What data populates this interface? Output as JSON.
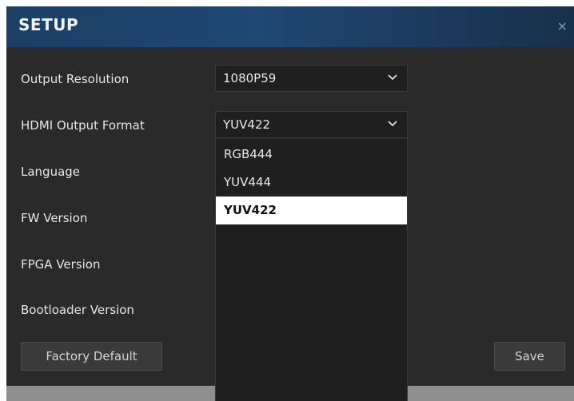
{
  "dialog": {
    "title": "SETUP",
    "close_glyph": "×"
  },
  "settings": {
    "output_resolution": {
      "label": "Output Resolution",
      "value": "1080P59"
    },
    "hdmi_output_format": {
      "label": "HDMI Output Format",
      "value": "YUV422",
      "options": [
        "RGB444",
        "YUV444",
        "YUV422"
      ],
      "selected": "YUV422"
    },
    "language": {
      "label": "Language"
    },
    "fw_version": {
      "label": "FW Version"
    },
    "fpga_version": {
      "label": "FPGA Version"
    },
    "bootloader_version": {
      "label": "Bootloader Version"
    }
  },
  "buttons": {
    "factory_default": "Factory Default",
    "save": "Save"
  },
  "icons": {
    "close": "close-icon",
    "chevron": "chevron-down-icon"
  },
  "colors": {
    "titlebar": "#1f4774",
    "dialog_bg": "#2a2a2a",
    "select_bg": "#1f1f1f",
    "highlight": "#ffffff"
  }
}
